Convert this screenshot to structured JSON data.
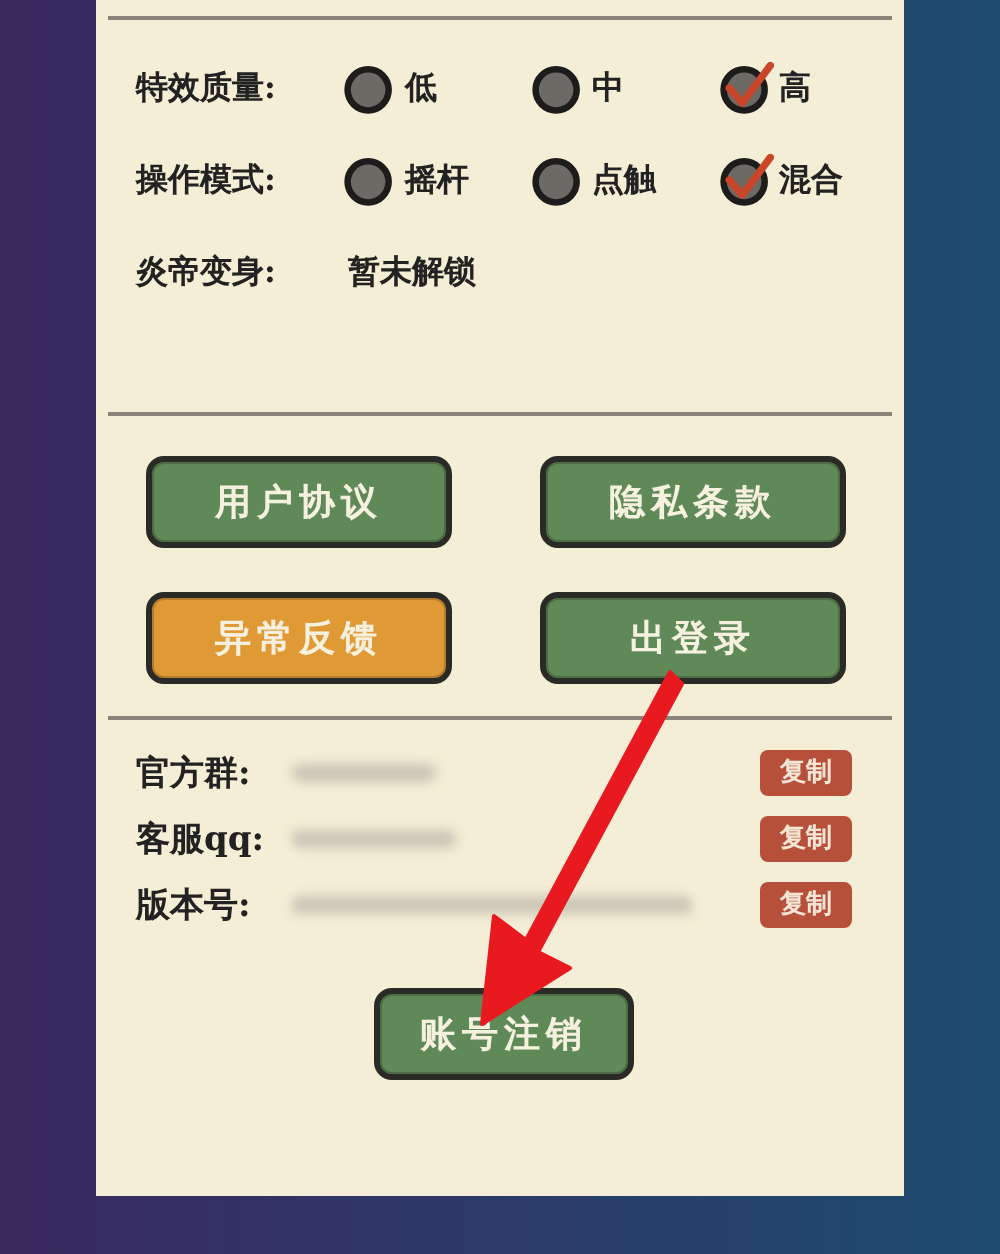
{
  "settings": [
    {
      "label": "特效质量:",
      "kind": "options",
      "options": [
        {
          "label": "低",
          "selected": false
        },
        {
          "label": "中",
          "selected": false
        },
        {
          "label": "高",
          "selected": true
        }
      ]
    },
    {
      "label": "操作模式:",
      "kind": "options",
      "options": [
        {
          "label": "摇杆",
          "selected": false
        },
        {
          "label": "点触",
          "selected": false
        },
        {
          "label": "混合",
          "selected": true
        }
      ]
    },
    {
      "label": "炎帝变身:",
      "kind": "text",
      "value": "暂未解锁"
    }
  ],
  "buttons": [
    {
      "label": "用户协议",
      "color": "#5f8a57"
    },
    {
      "label": "隐私条款",
      "color": "#5f8a57"
    },
    {
      "label": "异常反馈",
      "color": "#e09a35"
    },
    {
      "label": "出登录",
      "color": "#5f8a57"
    }
  ],
  "info": [
    {
      "label": "官方群:",
      "action": "复制"
    },
    {
      "label": "客服qq:",
      "action": "复制"
    },
    {
      "label": "版本号:",
      "action": "复制"
    }
  ],
  "bottom_button": {
    "label": "账号注销"
  }
}
